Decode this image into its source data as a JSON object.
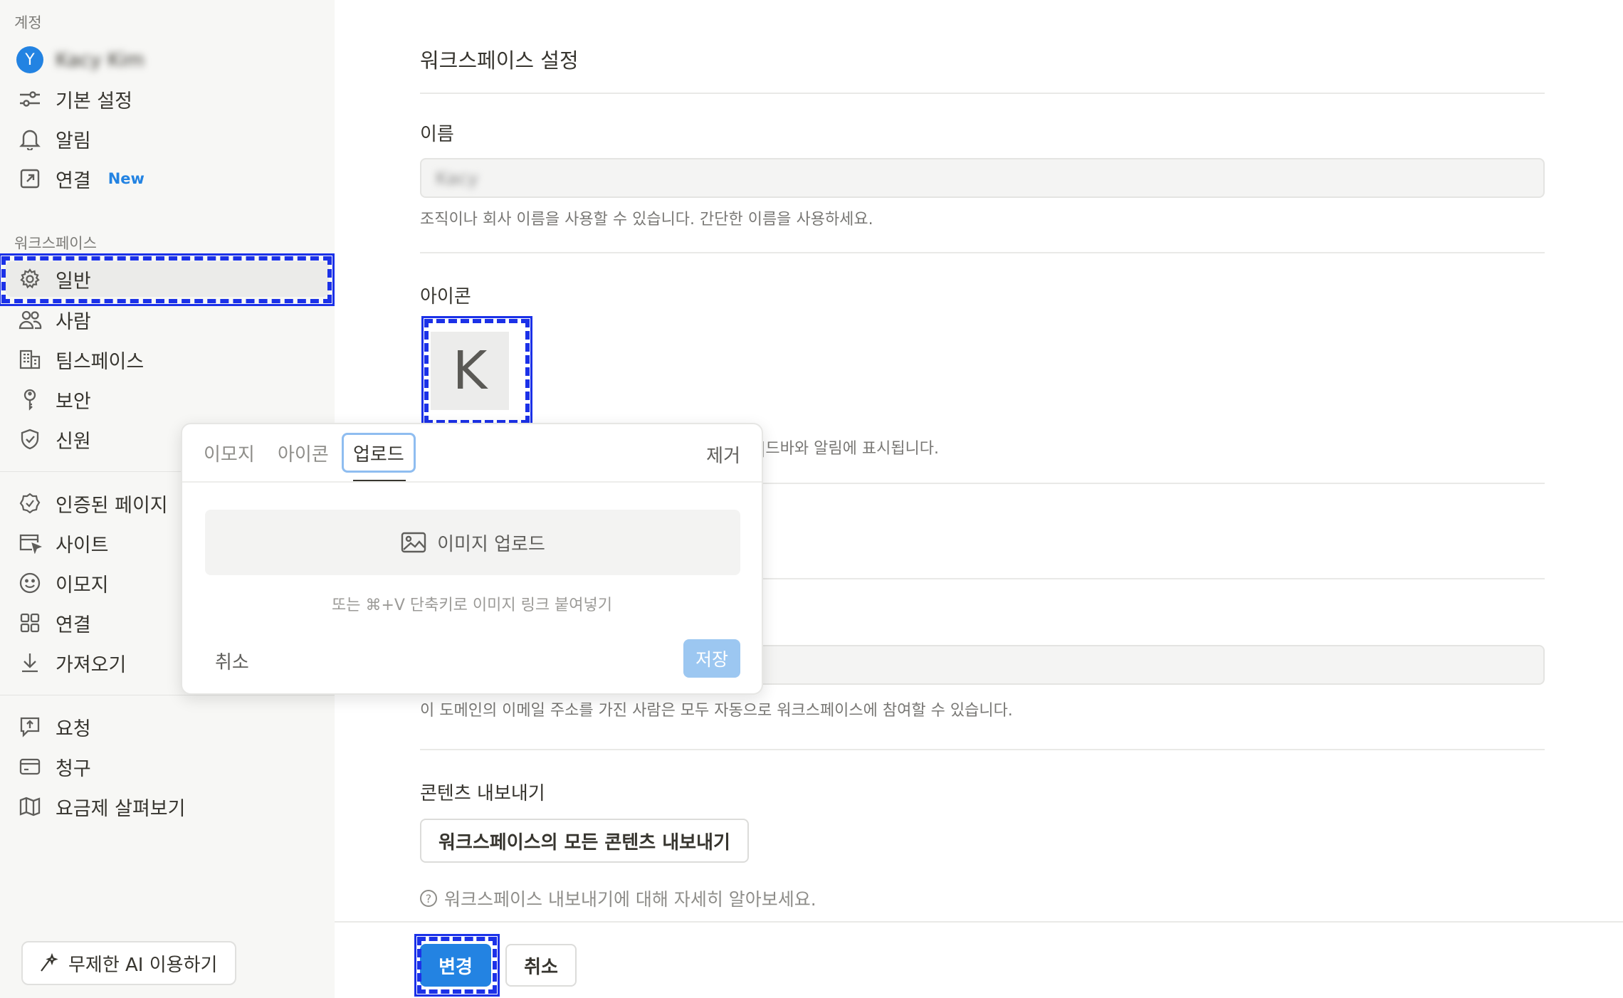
{
  "sidebar": {
    "account_label": "계정",
    "user": {
      "avatar_letter": "Y",
      "name": "Kacy Kim"
    },
    "account_items": [
      {
        "label": "기본 설정",
        "icon": "sliders-icon"
      },
      {
        "label": "알림",
        "icon": "bell-icon"
      },
      {
        "label": "연결",
        "icon": "arrow-out-square-icon",
        "badge": "New"
      }
    ],
    "workspace_label": "워크스페이스",
    "workspace_items": [
      {
        "label": "일반",
        "icon": "gear-icon",
        "active": true
      },
      {
        "label": "사람",
        "icon": "people-icon"
      },
      {
        "label": "팀스페이스",
        "icon": "building-icon"
      },
      {
        "label": "보안",
        "icon": "key-icon"
      },
      {
        "label": "신원",
        "icon": "shield-check-icon"
      }
    ],
    "feature_items": [
      {
        "label": "인증된 페이지",
        "icon": "verified-badge-icon"
      },
      {
        "label": "사이트",
        "icon": "browser-cursor-icon"
      },
      {
        "label": "이모지",
        "icon": "smiley-icon"
      },
      {
        "label": "연결",
        "icon": "grid-icon"
      },
      {
        "label": "가져오기",
        "icon": "download-arrow-icon"
      }
    ],
    "billing_items": [
      {
        "label": "요청",
        "icon": "request-upload-icon"
      },
      {
        "label": "청구",
        "icon": "credit-card-icon"
      },
      {
        "label": "요금제 살펴보기",
        "icon": "map-icon"
      }
    ],
    "ai_button": "무제한 AI 이용하기"
  },
  "main": {
    "title": "워크스페이스 설정",
    "name_label": "이름",
    "name_value": "Kacy",
    "name_hint": "조직이나 회사 이름을 사용할 수 있습니다. 간단한 이름을 사용하세요.",
    "icon_label": "아이콘",
    "icon_letter": "K",
    "icon_hint_partial": "|드바와 알림에 표시됩니다.",
    "domain_hint": "이 도메인의 이메일 주소를 가진 사람은 모두 자동으로 워크스페이스에 참여할 수 있습니다.",
    "export_label": "콘텐츠 내보내기",
    "export_button": "워크스페이스의 모든 콘텐츠 내보내기",
    "learn_more": "워크스페이스 내보내기에 대해 자세히 알아보세요.",
    "learn_icon": "?",
    "save_button": "변경",
    "cancel_button": "취소"
  },
  "popover": {
    "tabs": [
      "이모지",
      "아이콘",
      "업로드"
    ],
    "active_tab": "업로드",
    "remove": "제거",
    "upload_button": "이미지 업로드",
    "paste_hint": "또는 ⌘+V 단축키로 이미지 링크 붙여넣기",
    "cancel": "취소",
    "save": "저장"
  },
  "colors": {
    "accent": "#2383e2",
    "highlight": "#1b31e8",
    "sidebar_bg": "#f7f7f5"
  }
}
